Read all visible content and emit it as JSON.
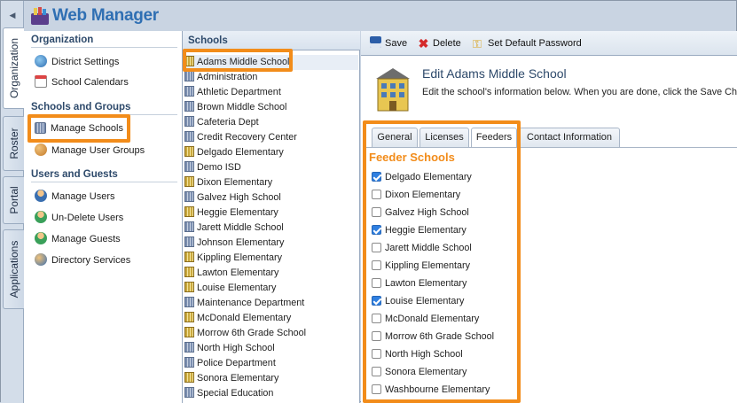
{
  "app": {
    "title": "Web Manager"
  },
  "vertical_tabs": [
    {
      "label": "Organization",
      "active": true
    },
    {
      "label": "Roster",
      "active": false
    },
    {
      "label": "Portal",
      "active": false
    },
    {
      "label": "Applications",
      "active": false
    }
  ],
  "nav": {
    "sections": [
      {
        "title": "Organization",
        "items": [
          "District Settings",
          "School Calendars"
        ]
      },
      {
        "title": "Schools and Groups",
        "items": [
          "Manage Schools",
          "Manage User Groups"
        ]
      },
      {
        "title": "Users and Guests",
        "items": [
          "Manage Users",
          "Un-Delete Users",
          "Manage Guests",
          "Directory Services"
        ]
      }
    ],
    "selected": "Manage Schools"
  },
  "schools": {
    "header": "Schools",
    "selected": "Adams Middle School",
    "items": [
      "Adams Middle School",
      "Administration",
      "Athletic Department",
      "Brown Middle School",
      "Cafeteria Dept",
      "Credit Recovery Center",
      "Delgado Elementary",
      "Demo ISD",
      "Dixon Elementary",
      "Galvez High School",
      "Heggie Elementary",
      "Jarett Middle School",
      "Johnson Elementary",
      "Kippling Elementary",
      "Lawton Elementary",
      "Louise Elementary",
      "Maintenance Department",
      "McDonald Elementary",
      "Morrow 6th Grade School",
      "North High School",
      "Police Department",
      "Sonora Elementary",
      "Special Education"
    ]
  },
  "toolbar": {
    "save": "Save",
    "delete": "Delete",
    "set_password": "Set Default Password"
  },
  "editor": {
    "title": "Edit Adams Middle School",
    "description": "Edit the school's information below. When you are done, click the Save Cha",
    "tabs": [
      "General",
      "Licenses",
      "Feeders",
      "Contact Information"
    ],
    "active_tab": "Feeders"
  },
  "feeders": {
    "title": "Feeder Schools",
    "items": [
      {
        "label": "Delgado Elementary",
        "checked": true
      },
      {
        "label": "Dixon Elementary",
        "checked": false
      },
      {
        "label": "Galvez High School",
        "checked": false
      },
      {
        "label": "Heggie Elementary",
        "checked": true
      },
      {
        "label": "Jarett Middle School",
        "checked": false
      },
      {
        "label": "Kippling Elementary",
        "checked": false
      },
      {
        "label": "Lawton Elementary",
        "checked": false
      },
      {
        "label": "Louise Elementary",
        "checked": true
      },
      {
        "label": "McDonald Elementary",
        "checked": false
      },
      {
        "label": "Morrow 6th Grade School",
        "checked": false
      },
      {
        "label": "North High School",
        "checked": false
      },
      {
        "label": "Sonora Elementary",
        "checked": false
      },
      {
        "label": "Washbourne Elementary",
        "checked": false
      }
    ]
  },
  "colors": {
    "highlight": "#f28c1a",
    "accent": "#2f6fb3",
    "checkbox": "#2f7fe0"
  }
}
